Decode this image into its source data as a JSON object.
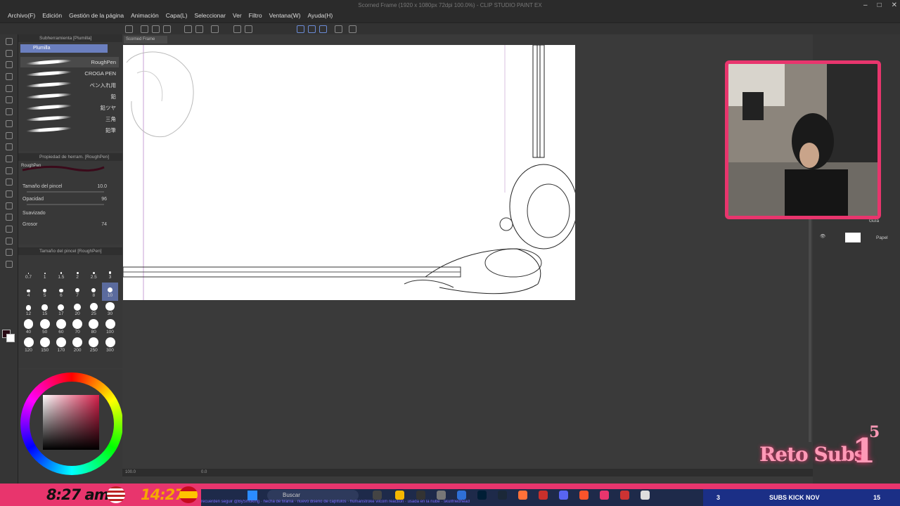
{
  "window": {
    "title": "Scorned Frame (1920 x 1080px 72dpi 100.0%) - CLIP STUDIO PAINT EX",
    "menus": [
      "Archivo(F)",
      "Edición",
      "Gestión de la página",
      "Animación",
      "Capa(L)",
      "Seleccionar",
      "Ver",
      "Filtro",
      "Ventana(W)",
      "Ayuda(H)"
    ]
  },
  "subtool": {
    "header": "Subherramienta [Plumilla]",
    "selected": "Plumilla",
    "brushes": [
      "RoughPen",
      "CROGA PEN",
      "ペン入れ用",
      "鉛",
      "鉛ツヤ",
      "三角",
      "鉛筆"
    ]
  },
  "toolprop": {
    "header": "Propiedad de herram. [RoughPen]",
    "brush_name": "RoughPen",
    "size_label": "Tamaño del pincel",
    "size_value": "10.0",
    "opacity_label": "Opacidad",
    "opacity_value": "96",
    "smoothing_label": "Suavizado",
    "thickness_label": "Grosor",
    "thickness_value": "74"
  },
  "sizepanel": {
    "header": "Tamaño del pincel [RoughPen]",
    "sizes": [
      "0.7",
      "1",
      "1.5",
      "2",
      "2.5",
      "3",
      "4",
      "5",
      "6",
      "7",
      "8",
      "10",
      "12",
      "15",
      "17",
      "20",
      "25",
      "30",
      "40",
      "50",
      "60",
      "70",
      "80",
      "100",
      "120",
      "150",
      "170",
      "200",
      "250",
      "300"
    ],
    "selected_size": "10"
  },
  "canvas": {
    "tab": "Scorned Frame",
    "zoom": "100.0",
    "rotation": "0.0"
  },
  "layers": {
    "items": [
      "Guía",
      "Papel"
    ]
  },
  "overlay": {
    "time_local": "8:27 am",
    "time_remote": "14:27",
    "search_placeholder": "Buscar",
    "ticker": "recuerden seguir @BySmoking · hecha de tiranía · nuevo diseño de capítulos · humanstroke vilcom reaction · usada en la nube · skullfriedhead",
    "goal_left": "3",
    "goal_label": "SUBS KICK NOV",
    "goal_right": "15",
    "reto_text": "Reto Subs",
    "reto_number": "1",
    "reto_sup": "5"
  },
  "colors": {
    "accent": "#e8356d",
    "selection": "#6b7fbf",
    "subs_bar": "#1b2f86",
    "foreground": "#2a0a14"
  }
}
